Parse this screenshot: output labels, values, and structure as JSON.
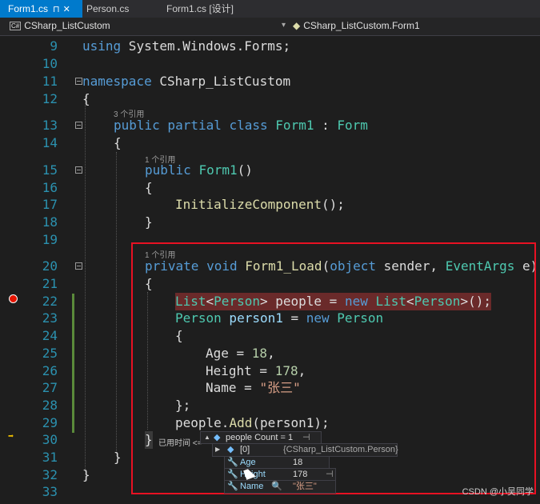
{
  "tabs": [
    {
      "label": "Form1.cs",
      "active": true,
      "pin": "⊓",
      "close": "✕"
    },
    {
      "label": "Person.cs",
      "active": false
    },
    {
      "label": "Form1.cs [设计]",
      "active": false
    }
  ],
  "nav": {
    "project": "CSharp_ListCustom",
    "class": "CSharp_ListCustom.Form1",
    "cs_badge": "C#"
  },
  "line_numbers": [
    "9",
    "10",
    "11",
    "12",
    "13",
    "14",
    "15",
    "16",
    "17",
    "18",
    "19",
    "20",
    "21",
    "22",
    "23",
    "24",
    "25",
    "26",
    "27",
    "28",
    "29",
    "30",
    "31",
    "32",
    "33"
  ],
  "lens": {
    "class_refs": "3 个引用",
    "ctor_refs": "1 个引用",
    "load_refs": "1 个引用"
  },
  "code": {
    "l9_kw": "using",
    "l9_rest": " System.Windows.Forms;",
    "l11_kw": "namespace",
    "l11_name": " CSharp_ListCustom",
    "l12": "{",
    "l13_a": "public partial class ",
    "l13_name": "Form1",
    "l13_colon": " : ",
    "l13_base": "Form",
    "l14": "{",
    "l15_kw": "public ",
    "l15_name": "Form1",
    "l15_p": "()",
    "l16": "{",
    "l17_fn": "InitializeComponent",
    "l17_p": "();",
    "l18": "}",
    "l20_kw": "private void ",
    "l20_fn": "Form1_Load",
    "l20_p1": "(",
    "l20_kw2": "object",
    "l20_p2": " sender, ",
    "l20_ty": "EventArgs",
    "l20_p3": " e)",
    "l21": "{",
    "l22_ty1": "List",
    "l22_p1": "<",
    "l22_ty2": "Person",
    "l22_p2": "> people = ",
    "l22_kw": "new ",
    "l22_ty3": "List",
    "l22_p3": "<",
    "l22_ty4": "Person",
    "l22_p4": ">();",
    "l23_ty": "Person",
    "l23_id": " person1",
    "l23_p": " = ",
    "l23_kw": "new ",
    "l23_ty2": "Person",
    "l24": "{",
    "l25_a": "Age = ",
    "l25_n": "18",
    "l25_c": ",",
    "l26_a": "Height = ",
    "l26_n": "178",
    "l26_c": ",",
    "l27_a": "Name = ",
    "l27_s": "\"张三\"",
    "l28": "};",
    "l29_a": "people.",
    "l29_fn": "Add",
    "l29_p": "(person1);",
    "l30": "}",
    "l31": "}",
    "l32": "}"
  },
  "debug": {
    "elapsed": "已用时间 <=",
    "people_row": "people  Count = 1",
    "item_index": "[0]",
    "item_type": "{CSharp_ListCustom.Person}",
    "age_label": "Age",
    "age_value": "18",
    "height_label": "Height",
    "height_value": "178",
    "name_label": "Name",
    "name_value": "\"张三\""
  },
  "watermark": "CSDN @小吴同学",
  "colors": {
    "accent": "#007acc",
    "highlight_box": "#e81123",
    "breakpoint": "#e51400"
  }
}
